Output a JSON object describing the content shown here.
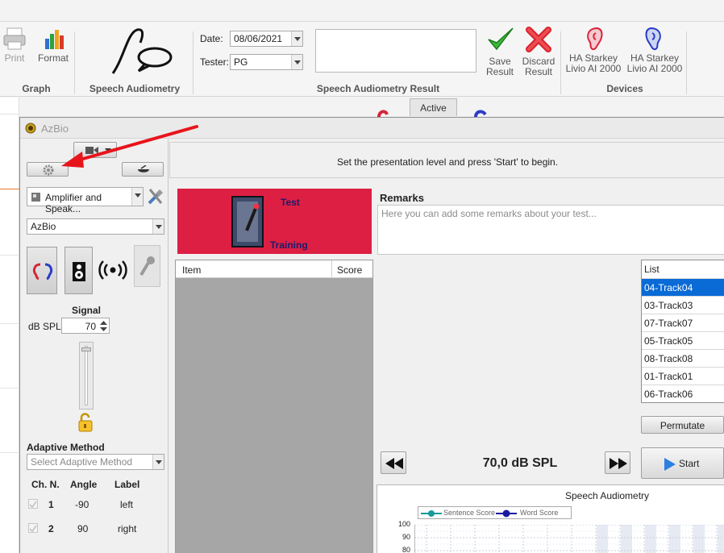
{
  "ribbon": {
    "graph_group": {
      "label": "Graph",
      "print_label": "Print",
      "format_label": "Format"
    },
    "speech_group": {
      "label": "Speech Audiometry"
    },
    "result_group": {
      "label": "Speech Audiometry Result",
      "date_label": "Date:",
      "date_value": "08/06/2021",
      "tester_label": "Tester:",
      "tester_value": "PG",
      "save_label_1": "Save",
      "save_label_2": "Result",
      "discard_label_1": "Discard",
      "discard_label_2": "Result"
    },
    "devices_group": {
      "label": "Devices",
      "device1_line1": "HA Starkey",
      "device1_line2": "Livio AI 2000",
      "device2_line1": "HA Starkey",
      "device2_line2": "Livio AI 2000"
    }
  },
  "active_tab": "Active",
  "azbio": {
    "title": "AzBio",
    "message": "Set the presentation level and press 'Start' to begin.",
    "transducer": "Amplifier and Speak...",
    "test_select": "AzBio",
    "signal_label": "Signal",
    "db_label": "dB SPL",
    "db_value": "70",
    "adaptive_label": "Adaptive Method",
    "adaptive_placeholder": "Select Adaptive Method",
    "channels": {
      "headers": [
        "Ch. N.",
        "Angle",
        "Label"
      ],
      "rows": [
        {
          "ch": "1",
          "angle": "-90",
          "label": "left"
        },
        {
          "ch": "2",
          "angle": "90",
          "label": "right"
        }
      ]
    },
    "banner_test": "Test",
    "banner_training": "Training",
    "remarks_title": "Remarks",
    "remarks_placeholder": "Here you can add some remarks about your test...",
    "table_headers": {
      "item": "Item",
      "score": "Score"
    },
    "list_header": "List",
    "list_items": [
      "04-Track04",
      "03-Track03",
      "07-Track07",
      "05-Track05",
      "08-Track08",
      "01-Track01",
      "06-Track06"
    ],
    "permutate": "Permutate",
    "level": "70,0 dB SPL",
    "start": "Start",
    "chart": {
      "title": "Speech Audiometry",
      "legend": [
        "Sentence Score",
        "Word Score"
      ],
      "y_ticks": [
        "100",
        "90",
        "80"
      ]
    }
  },
  "colors": {
    "banner_red": "#dd1f44",
    "selection_blue": "#0a6ad6",
    "annotation_arrow": "#e8141c",
    "sentence_series": "#1a9a9a",
    "word_series": "#1a1aa0"
  },
  "icons": {
    "print": "printer-icon",
    "format": "bar-chart-icon",
    "speech": "speech-curve-icon",
    "save": "check-icon",
    "discard": "x-icon",
    "device_left": "red-ear-icon",
    "device_right": "blue-ear-icon"
  }
}
